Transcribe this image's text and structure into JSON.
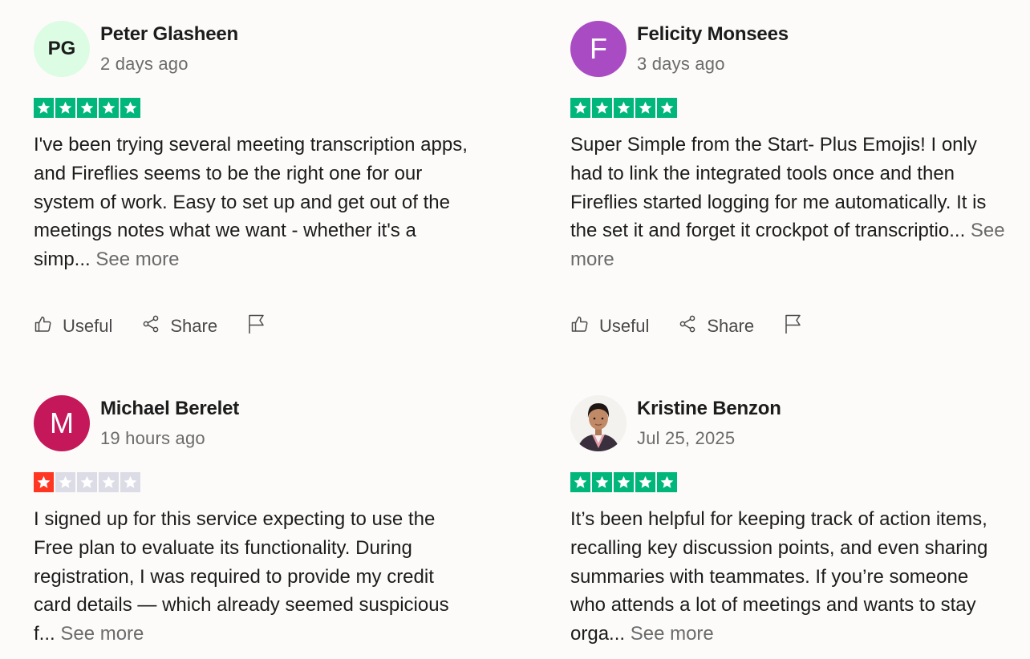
{
  "colors": {
    "star_green": "#00b67a",
    "star_red": "#ff3722",
    "star_empty": "#dcdce6",
    "muted_text": "#6b6b6b"
  },
  "actions": {
    "useful_label": "Useful",
    "share_label": "Share"
  },
  "reviews": [
    {
      "name": "Peter Glasheen",
      "date": "2 days ago",
      "avatar": {
        "type": "initials",
        "text": "PG",
        "bg": "#dcfce4",
        "fg": "#1c1c1c"
      },
      "rating": 5,
      "text": "I've been trying several meeting transcription apps, and Fireflies seems to be the right one for our system of work. Easy to set up and get out of the meetings notes what we want - whether it's a simp...",
      "see_more": "See more"
    },
    {
      "name": "Felicity Monsees",
      "date": "3 days ago",
      "avatar": {
        "type": "letter",
        "text": "F",
        "bg": "#a94bc3",
        "fg": "#ffffff"
      },
      "rating": 5,
      "text": "Super Simple from the Start- Plus Emojis! I only had to link the integrated tools once and then Fireflies started logging for me automatically. It is the set it and forget it crockpot of transcriptio...",
      "see_more": "See more"
    },
    {
      "name": "Michael Berelet",
      "date": "19 hours ago",
      "avatar": {
        "type": "letter",
        "text": "M",
        "bg": "#c4185a",
        "fg": "#ffffff"
      },
      "rating": 1,
      "text": "I signed up for this service expecting to use the Free plan to evaluate its functionality. During registration, I was required to provide my credit card details — which already seemed suspicious f...",
      "see_more": "See more"
    },
    {
      "name": "Kristine Benzon",
      "date": "Jul 25, 2025",
      "avatar": {
        "type": "photo",
        "text": "",
        "bg": "#f4f2ee",
        "fg": "#1c1c1c"
      },
      "rating": 5,
      "text": "It’s been helpful for keeping track of action items, recalling key discussion points, and even sharing summaries with teammates. If you’re someone who attends a lot of meetings and wants to stay orga...",
      "see_more": "See more"
    }
  ]
}
